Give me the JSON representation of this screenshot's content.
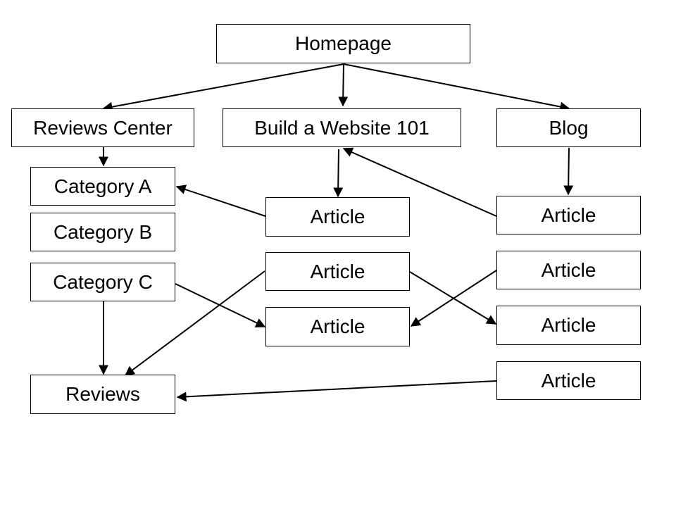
{
  "nodes": [
    {
      "id": "homepage",
      "label": "Homepage"
    },
    {
      "id": "reviews-center",
      "label": "Reviews Center"
    },
    {
      "id": "build-website",
      "label": "Build a Website 101"
    },
    {
      "id": "blog",
      "label": "Blog"
    },
    {
      "id": "category-a",
      "label": "Category A"
    },
    {
      "id": "category-b",
      "label": "Category B"
    },
    {
      "id": "category-c",
      "label": "Category C"
    },
    {
      "id": "reviews",
      "label": "Reviews"
    },
    {
      "id": "article-mid-1",
      "label": "Article"
    },
    {
      "id": "article-mid-2",
      "label": "Article"
    },
    {
      "id": "article-mid-3",
      "label": "Article"
    },
    {
      "id": "article-blog-1",
      "label": "Article"
    },
    {
      "id": "article-blog-2",
      "label": "Article"
    },
    {
      "id": "article-blog-3",
      "label": "Article"
    },
    {
      "id": "article-blog-4",
      "label": "Article"
    }
  ],
  "edges": [
    {
      "from": "homepage",
      "to": "reviews-center"
    },
    {
      "from": "homepage",
      "to": "build-website"
    },
    {
      "from": "homepage",
      "to": "blog"
    },
    {
      "from": "reviews-center",
      "to": "category-a"
    },
    {
      "from": "build-website",
      "to": "article-mid-1"
    },
    {
      "from": "blog",
      "to": "article-blog-1"
    },
    {
      "from": "article-mid-1",
      "to": "category-a"
    },
    {
      "from": "article-blog-1",
      "to": "build-website"
    },
    {
      "from": "category-c",
      "to": "article-mid-3"
    },
    {
      "from": "article-mid-2",
      "to": "reviews"
    },
    {
      "from": "article-mid-2",
      "to": "article-blog-3"
    },
    {
      "from": "article-blog-2",
      "to": "article-mid-3"
    },
    {
      "from": "category-c",
      "to": "reviews"
    },
    {
      "from": "article-blog-4",
      "to": "reviews"
    }
  ]
}
